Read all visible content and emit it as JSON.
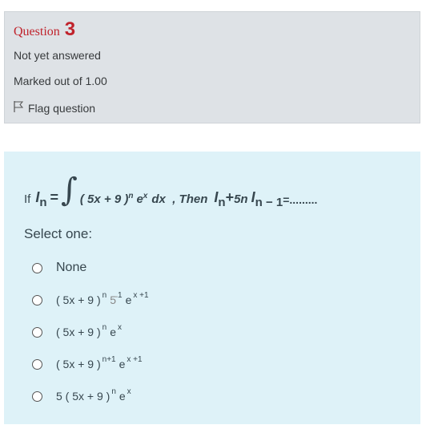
{
  "info": {
    "question_label": "Question",
    "question_number": "3",
    "state": "Not yet answered",
    "grade": "Marked out of 1.00",
    "flag_label": "Flag question"
  },
  "question": {
    "if": "If",
    "i_symbol": "I",
    "i_sub": "n",
    "equals": "=",
    "integral": "∫",
    "body": "( 5x + 9 )",
    "body_sup": "n",
    "body_e": "e",
    "body_e_sup": "x",
    "body_tail": "dx  , Then",
    "plus": "+",
    "five_n": "5n",
    "i_sub2": "n − 1",
    "tail": "=........."
  },
  "prompt": "Select one:",
  "options": [
    {
      "text": "None"
    },
    {
      "main": "( 5x + 9  )",
      "sup1": "n",
      "extra": "5̄",
      "sup2": "1",
      "e": "e",
      "e_sup": "x +1"
    },
    {
      "main": "( 5x + 9  )",
      "sup1": "n",
      "e": "e",
      "e_sup": "x"
    },
    {
      "main": "( 5x + 9  )",
      "sup1": "n+1",
      "e": "e",
      "e_sup": "x +1"
    },
    {
      "main": "5 ( 5x + 9  )",
      "sup1": "n",
      "e": "e",
      "e_sup": "x"
    }
  ]
}
